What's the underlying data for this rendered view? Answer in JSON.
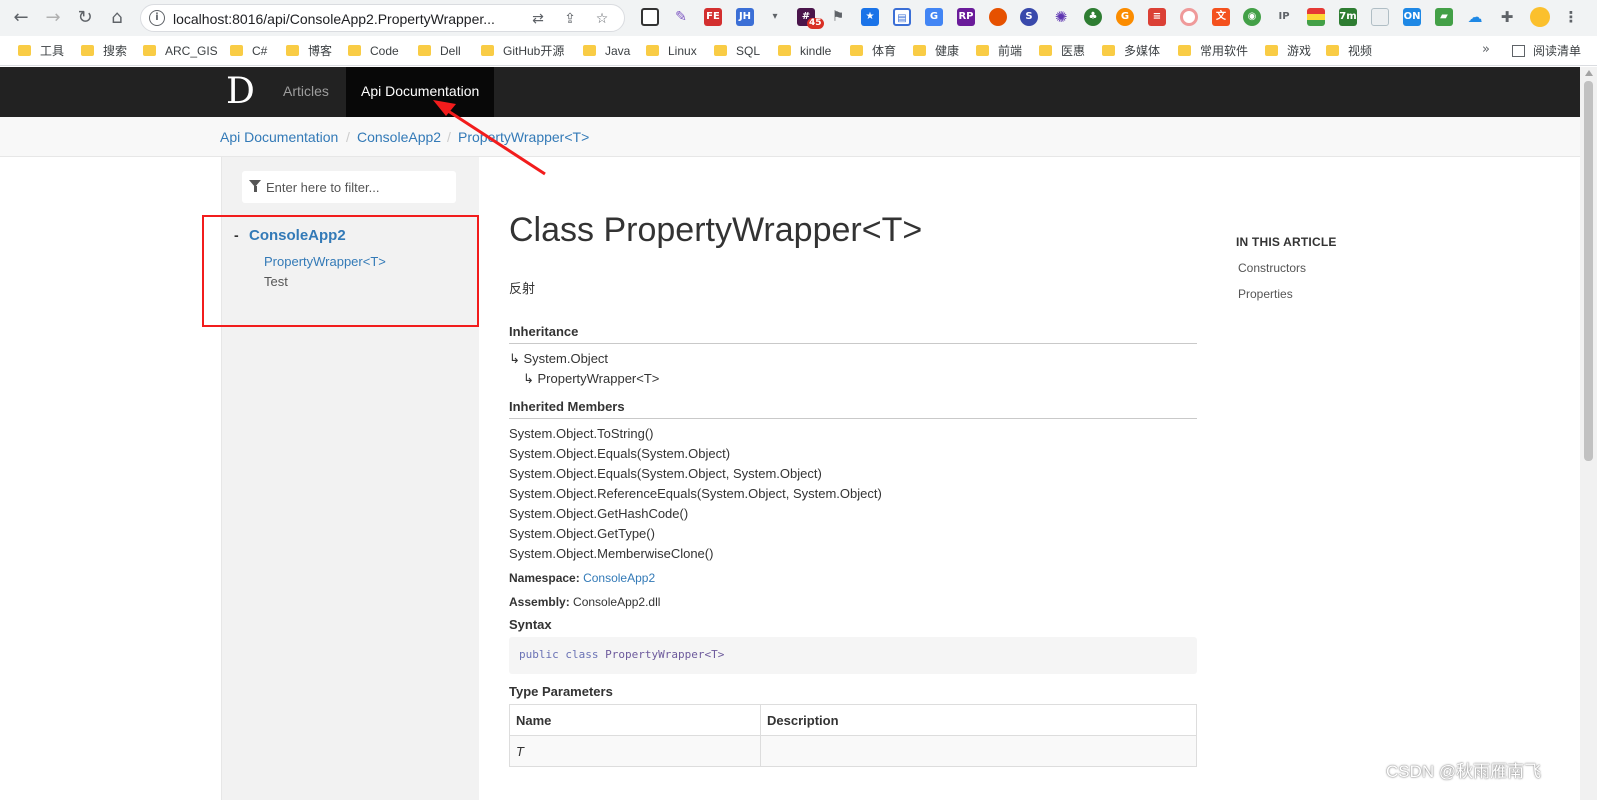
{
  "browser": {
    "url": "localhost:8016/api/ConsoleApp2.PropertyWrapper...",
    "nav": {
      "back": "←",
      "forward": "→",
      "reload": "↻",
      "home": "⌂"
    },
    "extension_icons": [
      "qr-icon",
      "quill-icon",
      "fe-icon",
      "jh-icon",
      "dropdown-icon",
      "slack-icon",
      "bookmark-icon",
      "star-ext-icon",
      "tab-icon",
      "translate-icon",
      "rp-icon",
      "firefox-icon",
      "s-icon",
      "gear-ext-icon",
      "leaf-icon",
      "g-icon",
      "todo-icon",
      "circle-icon",
      "ya-icon",
      "globe-icon",
      "ip-icon",
      "color-icon",
      "timer-icon",
      "monitor-icon",
      "on-icon",
      "flag-icon",
      "cloud-icon",
      "puzzle-icon",
      "profile-icon",
      "menu-icon"
    ],
    "extension_badges": {
      "slack": "45",
      "fe": "FE",
      "jh": "JH",
      "rp": "RP",
      "ip": "IP",
      "timer": "7m",
      "on": "ON"
    },
    "bookmarks": [
      "工具",
      "搜索",
      "ARC_GIS",
      "C#",
      "博客",
      "Code",
      "Dell",
      "GitHub开源",
      "Java",
      "Linux",
      "SQL",
      "kindle",
      "体育",
      "健康",
      "前端",
      "医惠",
      "多媒体",
      "常用软件",
      "游戏",
      "视频"
    ],
    "bookmarks_more": "»",
    "reading_list": "阅读清单"
  },
  "nav": {
    "logo": "D",
    "articles": "Articles",
    "api": "Api Documentation"
  },
  "breadcrumb": [
    "Api Documentation",
    "ConsoleApp2",
    "PropertyWrapper<T>"
  ],
  "breadcrumb_sep": "/",
  "sidebar": {
    "filter_placeholder": "Enter here to filter...",
    "expander": "-",
    "namespace": "ConsoleApp2",
    "items": [
      "PropertyWrapper<T>",
      "Test"
    ]
  },
  "article": {
    "title": "Class PropertyWrapper<T>",
    "summary": "反射",
    "inheritance_heading": "Inheritance",
    "inheritance": [
      "↳ System.Object",
      "↳ PropertyWrapper<T>"
    ],
    "inherited_heading": "Inherited Members",
    "inherited": [
      "System.Object.ToString()",
      "System.Object.Equals(System.Object)",
      "System.Object.Equals(System.Object, System.Object)",
      "System.Object.ReferenceEquals(System.Object, System.Object)",
      "System.Object.GetHashCode()",
      "System.Object.GetType()",
      "System.Object.MemberwiseClone()"
    ],
    "namespace_label": "Namespace:",
    "namespace_value": "ConsoleApp2",
    "assembly_label": "Assembly:",
    "assembly_value": "ConsoleApp2.dll",
    "syntax_heading": "Syntax",
    "syntax": {
      "kw1": "public",
      "kw2": "class",
      "name": "PropertyWrapper<T>"
    },
    "type_params_heading": "Type Parameters",
    "table_headers": [
      "Name",
      "Description"
    ],
    "table_rows": [
      [
        "T",
        ""
      ]
    ]
  },
  "aside": {
    "heading": "IN THIS ARTICLE",
    "items": [
      "Constructors",
      "Properties"
    ]
  },
  "watermark": "CSDN @秋雨雁南飞",
  "colors": {
    "annotation": "#f21c1c",
    "link": "#337ab7",
    "navbar": "#222222"
  }
}
